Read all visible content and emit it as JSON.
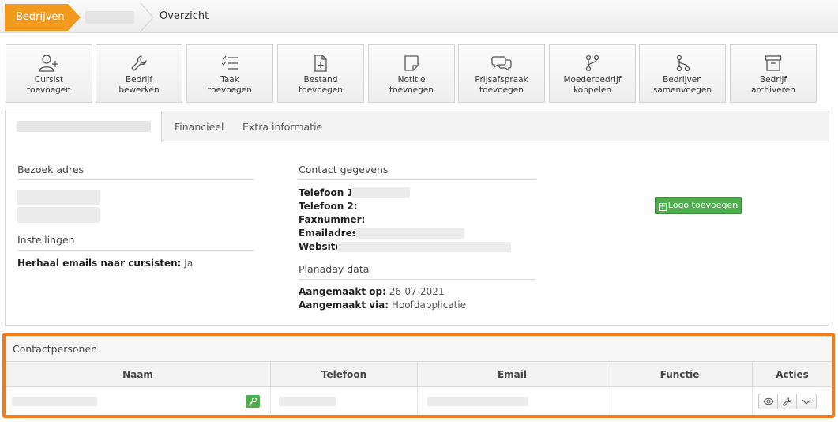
{
  "breadcrumb": {
    "first": "Bedrijven",
    "current": "Overzicht"
  },
  "actions": [
    {
      "label1": "Cursist",
      "label2": "toevoegen",
      "icon": "user-plus-icon"
    },
    {
      "label1": "Bedrijf",
      "label2": "bewerken",
      "icon": "wrench-icon"
    },
    {
      "label1": "Taak",
      "label2": "toevoegen",
      "icon": "checklist-icon"
    },
    {
      "label1": "Bestand",
      "label2": "toevoegen",
      "icon": "file-plus-icon"
    },
    {
      "label1": "Notitie",
      "label2": "toevoegen",
      "icon": "note-icon"
    },
    {
      "label1": "Prijsafspraak",
      "label2": "toevoegen",
      "icon": "chat-bubbles-icon"
    },
    {
      "label1": "Moederbedrijf",
      "label2": "koppelen",
      "icon": "git-branch-icon"
    },
    {
      "label1": "Bedrijven",
      "label2": "samenvoegen",
      "icon": "merge-icon"
    },
    {
      "label1": "Bedrijf",
      "label2": "archiveren",
      "icon": "archive-icon"
    }
  ],
  "tabs": [
    "Financieel",
    "Extra informatie"
  ],
  "left": {
    "address_title": "Bezoek adres",
    "settings_title": "Instellingen",
    "repeat_label": "Herhaal emails naar cursisten:",
    "repeat_value": "Ja"
  },
  "contact": {
    "title": "Contact gegevens",
    "phone1": "Telefoon 1:",
    "phone2": "Telefoon 2:",
    "fax": "Faxnummer:",
    "email": "Emailadres:",
    "website": "Website:"
  },
  "planaday": {
    "title": "Planaday data",
    "created_on_label": "Aangemaakt op:",
    "created_on_value": "26-07-2021",
    "created_via_label": "Aangemaakt via:",
    "created_via_value": "Hoofdapplicatie"
  },
  "logo_button": "Logo toevoegen",
  "contactpersons": {
    "title": "Contactpersonen",
    "columns": [
      "Naam",
      "Telefoon",
      "Email",
      "Functie",
      "Acties"
    ]
  },
  "colors": {
    "accent": "#f39a1e",
    "highlight_border": "#f27a1a",
    "green": "#4cae4c"
  }
}
